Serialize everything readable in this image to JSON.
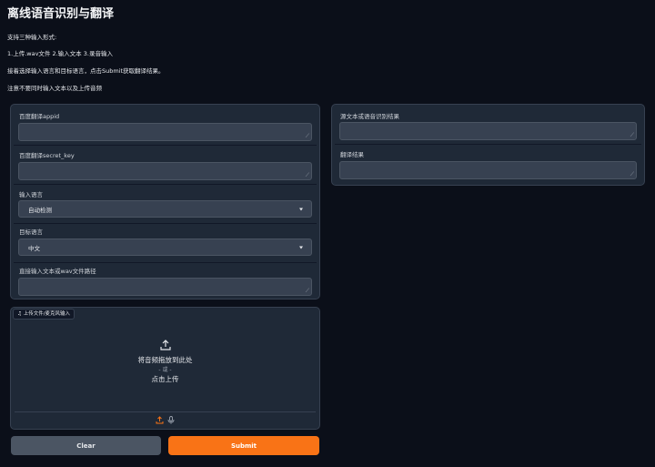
{
  "header": {
    "title": "离线语音识别与翻译"
  },
  "description": {
    "line1": "支持三种输入形式:",
    "line2": "1.上传.wav文件 2.输入文本 3.录音输入",
    "line3": "接着选择输入语言和目标语言，点击Submit获取翻译结果。",
    "line4": "注意不要同时输入文本以及上传音频"
  },
  "inputs": {
    "appid_label": "百度翻译appid",
    "appid_value": "",
    "secret_label": "百度翻译secret_key",
    "secret_value": "",
    "input_lang_label": "输入语言",
    "input_lang_value": "自动检测",
    "target_lang_label": "目标语言",
    "target_lang_value": "中文",
    "text_label": "直接输入文本或wav文件路径",
    "text_value": ""
  },
  "upload": {
    "tab_label": "上传文件/麦克风输入",
    "drop_text": "将音频拖放到此处",
    "or_text": "- 或 -",
    "click_text": "点击上传"
  },
  "buttons": {
    "clear": "Clear",
    "submit": "Submit"
  },
  "outputs": {
    "source_label": "源文本或语音识别结果",
    "source_value": "",
    "result_label": "翻译结果",
    "result_value": ""
  },
  "colors": {
    "background": "#0b0f19",
    "panel": "#1f2937",
    "field": "#374151",
    "accent": "#f97316",
    "secondary_button": "#4b5563"
  },
  "icons": {
    "upload": "upload-arrow-icon",
    "mic": "microphone-icon",
    "music": "music-note-icon"
  }
}
